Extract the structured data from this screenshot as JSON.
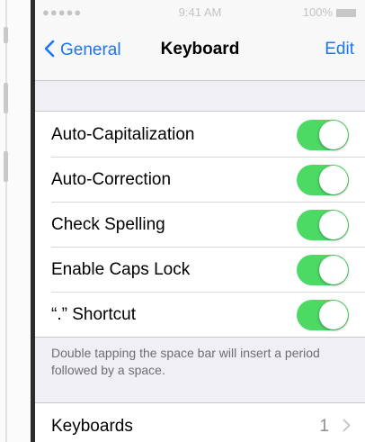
{
  "status_bar": {
    "signal": "●●●●● ",
    "time": "9:41 AM",
    "battery": "100%"
  },
  "navbar": {
    "back_label": "General",
    "title": "Keyboard",
    "edit_label": "Edit"
  },
  "settings": [
    {
      "label": "Auto-Capitalization",
      "on": true
    },
    {
      "label": "Auto-Correction",
      "on": true
    },
    {
      "label": "Check Spelling",
      "on": true
    },
    {
      "label": "Enable Caps Lock",
      "on": true
    },
    {
      "label": "“.” Shortcut",
      "on": true
    }
  ],
  "footer_note": "Double tapping the space bar will insert a period followed by a space.",
  "keyboards": {
    "label": "Keyboards",
    "value": "1"
  },
  "colors": {
    "accent": "#1777f5",
    "toggle_on": "#4cd964"
  }
}
